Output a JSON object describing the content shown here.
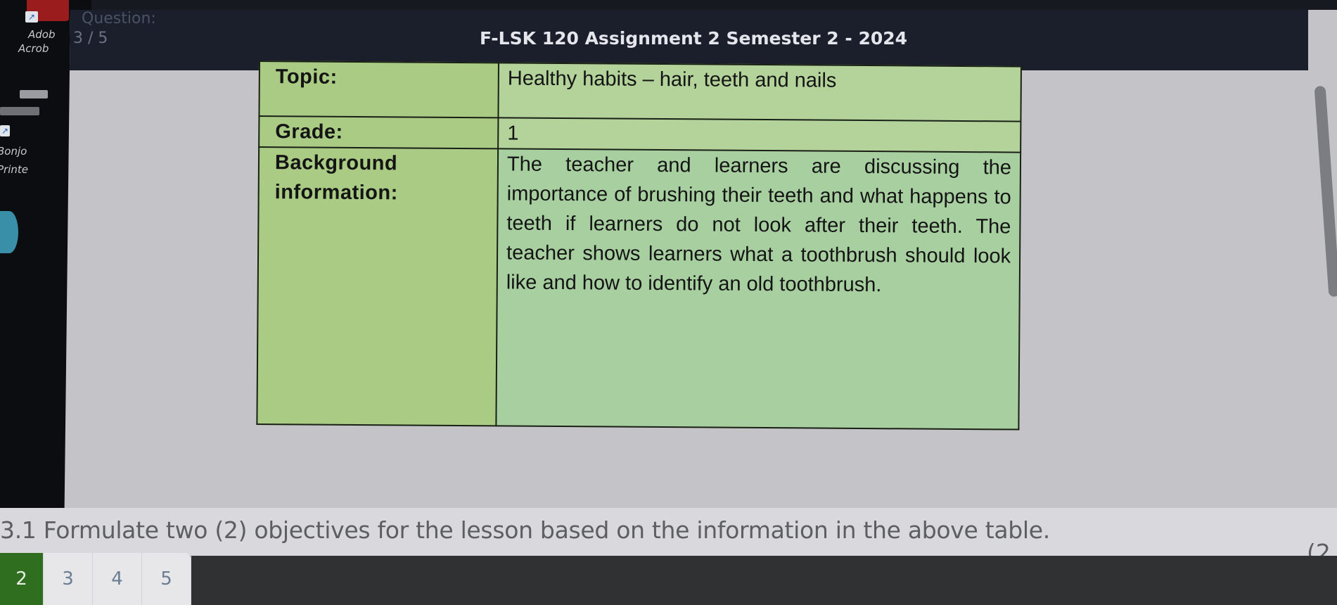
{
  "desktop": {
    "labels": [
      "Adob",
      "Acrob",
      "Bonjo",
      "Printe"
    ]
  },
  "window": {
    "question_label": "Question:",
    "question_counter": "3 / 5",
    "doc_title": "F-LSK 120 Assignment 2 Semester 2 - 2024"
  },
  "table": {
    "rows": [
      {
        "label": "Topic:",
        "value": "Healthy habits – hair, teeth and nails"
      },
      {
        "label": "Grade:",
        "value": "1"
      },
      {
        "label": "Background information:",
        "value": "The teacher and learners are discussing the importance of brushing their teeth and what happens to teeth if learners do not look after their teeth. The teacher shows learners what a toothbrush should look like and how to identify an old toothbrush."
      }
    ]
  },
  "question": {
    "text": "3.1 Formulate two (2) objectives for the lesson based on the information in the above table.",
    "marks": "(2"
  },
  "page_nav": {
    "pages": [
      "2",
      "3",
      "4",
      "5"
    ],
    "active": "2"
  },
  "colors": {
    "table_green": "#a9cb83",
    "active_page": "#2f6e1f",
    "titlebar": "#1a1f2b"
  }
}
